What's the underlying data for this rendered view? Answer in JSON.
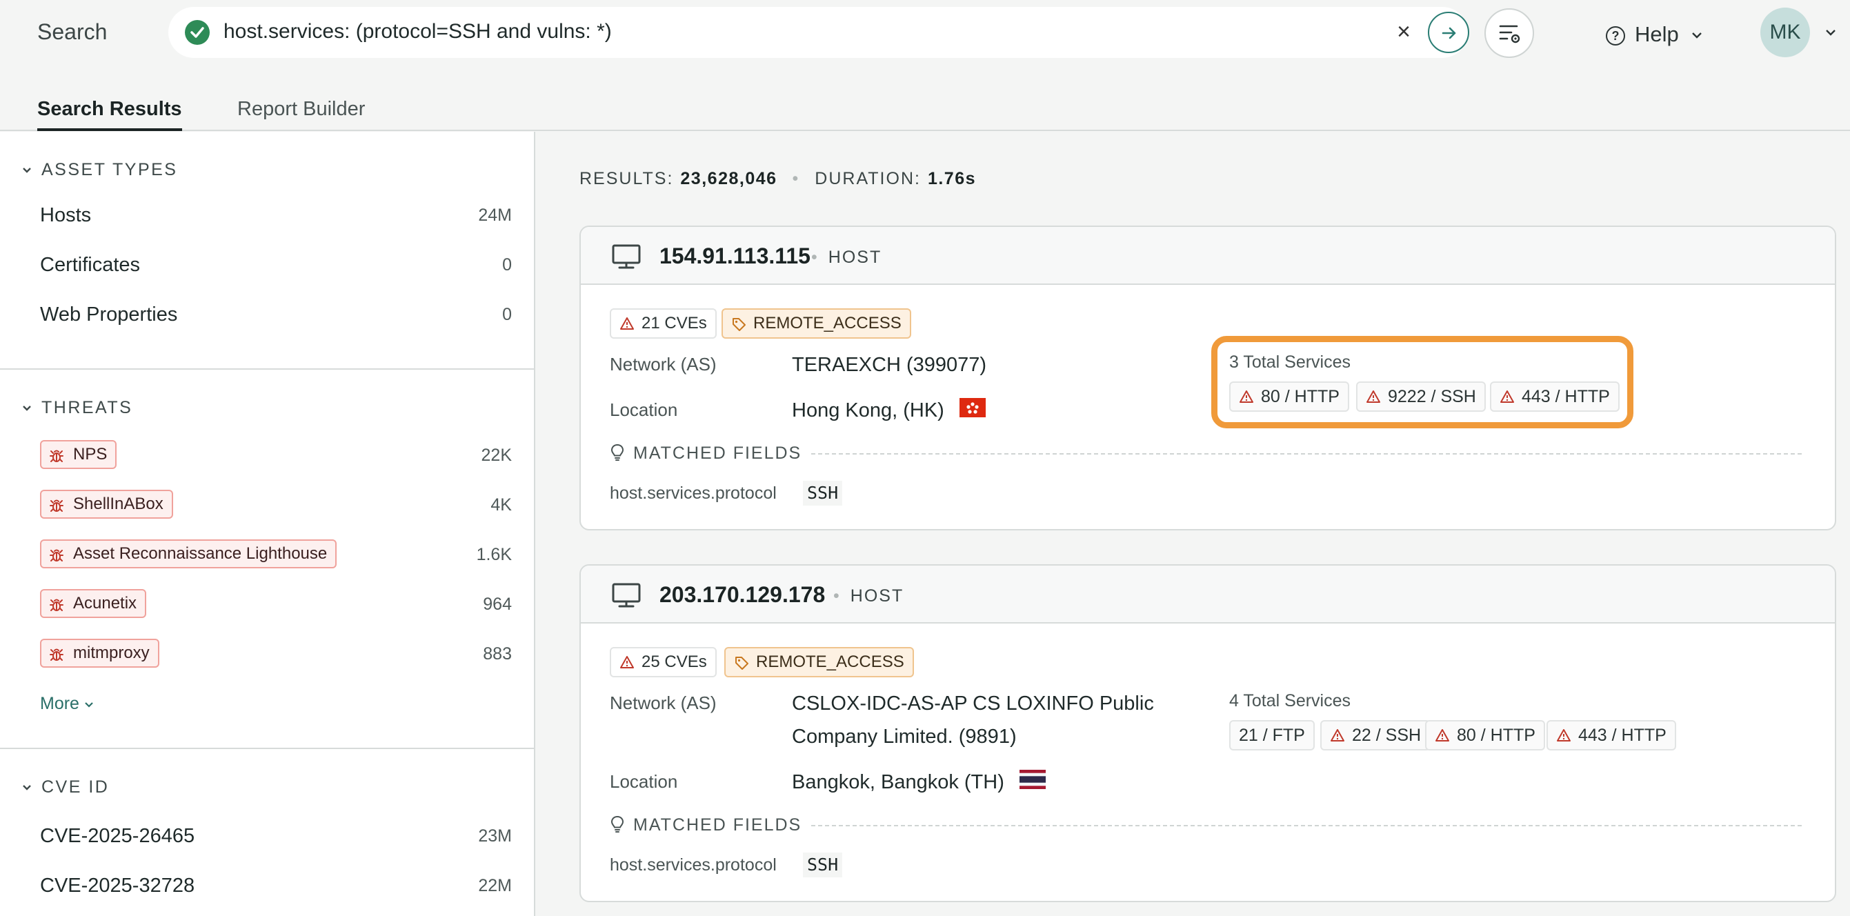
{
  "topbar": {
    "search_label": "Search",
    "query": "host.services: (protocol=SSH and vulns: *)",
    "clear_glyph": "×",
    "help_label": "Help",
    "avatar_initials": "MK"
  },
  "tabs": [
    {
      "label": "Search Results",
      "active": true
    },
    {
      "label": "Report Builder",
      "active": false
    }
  ],
  "sidebar": {
    "asset_types": {
      "title": "ASSET TYPES",
      "items": [
        {
          "label": "Hosts",
          "count": "24M"
        },
        {
          "label": "Certificates",
          "count": "0"
        },
        {
          "label": "Web Properties",
          "count": "0"
        }
      ]
    },
    "threats": {
      "title": "THREATS",
      "items": [
        {
          "label": "NPS",
          "count": "22K"
        },
        {
          "label": "ShellInABox",
          "count": "4K"
        },
        {
          "label": "Asset Reconnaissance Lighthouse",
          "count": "1.6K"
        },
        {
          "label": "Acunetix",
          "count": "964"
        },
        {
          "label": "mitmproxy",
          "count": "883"
        }
      ],
      "more_label": "More"
    },
    "cve_id": {
      "title": "CVE ID",
      "items": [
        {
          "label": "CVE-2025-26465",
          "count": "23M"
        },
        {
          "label": "CVE-2025-32728",
          "count": "22M"
        }
      ]
    }
  },
  "results": {
    "results_label": "RESULTS:",
    "results_value": "23,628,046",
    "duration_label": "DURATION:",
    "duration_value": "1.76s"
  },
  "cards": [
    {
      "ip": "154.91.113.115",
      "type": "HOST",
      "cves": "21 CVEs",
      "label_tag": "REMOTE_ACCESS",
      "network_label": "Network (AS)",
      "network_value": "TERAEXCH (399077)",
      "location_label": "Location",
      "location_value": "Hong Kong, (HK)",
      "services_title": "3 Total Services",
      "services": [
        "80 / HTTP",
        "9222 / SSH",
        "443 / HTTP"
      ],
      "matched_title": "MATCHED FIELDS",
      "matched_key": "host.services.protocol",
      "matched_value": "SSH"
    },
    {
      "ip": "203.170.129.178",
      "type": "HOST",
      "cves": "25 CVEs",
      "label_tag": "REMOTE_ACCESS",
      "network_label": "Network (AS)",
      "network_value": "CSLOX-IDC-AS-AP CS LOXINFO Public Company Limited. (9891)",
      "location_label": "Location",
      "location_value": "Bangkok, Bangkok (TH)",
      "services_title": "4 Total Services",
      "services": [
        "21 / FTP",
        "22 / SSH",
        "80 / HTTP",
        "443 / HTTP"
      ],
      "matched_title": "MATCHED FIELDS",
      "matched_key": "host.services.protocol",
      "matched_value": "SSH"
    }
  ],
  "colors": {
    "accent": "#2a7d74",
    "highlight": "#f09a3a",
    "threat_border": "#f0a29c",
    "vuln_red": "#c0392b"
  }
}
